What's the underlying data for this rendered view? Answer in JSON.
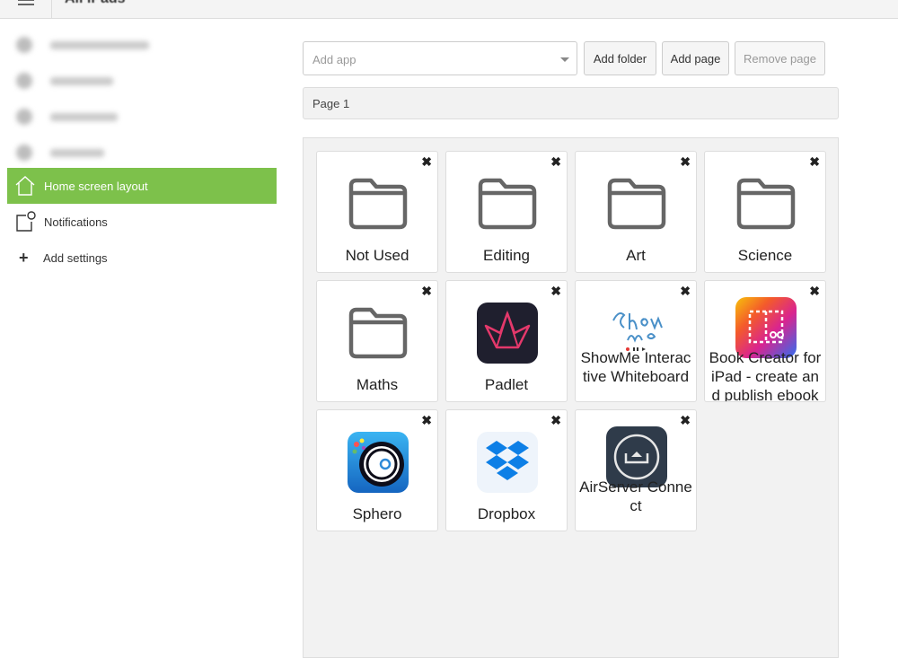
{
  "header": {
    "title": "All iPads"
  },
  "sidebar": {
    "items": [
      {
        "label": "Home screen layout",
        "icon": "home-icon",
        "active": true
      },
      {
        "label": "Notifications",
        "icon": "notification-icon",
        "active": false
      },
      {
        "label": "Add settings",
        "icon": "plus-icon",
        "active": false
      }
    ]
  },
  "toolbar": {
    "add_app_placeholder": "Add app",
    "add_folder": "Add folder",
    "add_page": "Add page",
    "remove_page": "Remove page"
  },
  "page": {
    "label": "Page 1"
  },
  "tiles": [
    {
      "label": "Not Used",
      "type": "folder"
    },
    {
      "label": "Editing",
      "type": "folder"
    },
    {
      "label": "Art",
      "type": "folder"
    },
    {
      "label": "Science",
      "type": "folder"
    },
    {
      "label": "Maths",
      "type": "folder"
    },
    {
      "label": "Padlet",
      "type": "app",
      "icon": "padlet-icon"
    },
    {
      "label": "ShowMe Interactive Whiteboard",
      "type": "app",
      "icon": "showme-icon"
    },
    {
      "label": "Book Creator for iPad - create and publish ebooks",
      "type": "app",
      "icon": "book-creator-icon"
    },
    {
      "label": "Sphero",
      "type": "app",
      "icon": "sphero-icon"
    },
    {
      "label": "Dropbox",
      "type": "app",
      "icon": "dropbox-icon"
    },
    {
      "label": "AirServer Connect",
      "type": "app",
      "icon": "airserver-icon"
    }
  ],
  "colors": {
    "accent": "#7dc14b"
  }
}
